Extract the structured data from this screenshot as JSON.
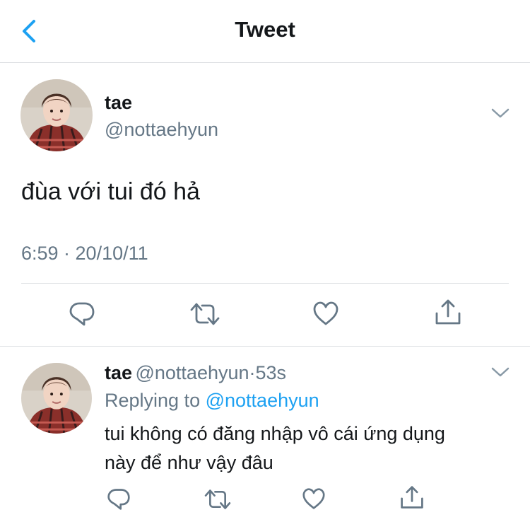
{
  "nav": {
    "title": "Tweet"
  },
  "main_tweet": {
    "name": "tae",
    "handle": "@nottaehyun",
    "text": "đùa với tui đó hả",
    "timestamp": "6:59 · 20/10/11"
  },
  "reply": {
    "name": "tae",
    "handle": "@nottaehyun",
    "separator": "·",
    "time": "53s",
    "replying_prefix": "Replying to",
    "replying_handle": "@nottaehyun",
    "text_line1": "tui không có đăng nhập vô cái ứng dụng",
    "text_line2": "này để như vậy đâu"
  },
  "colors": {
    "accent": "#1da1f2",
    "icon_gray": "#657786",
    "text": "#14171a",
    "divider": "#dcdfe2"
  },
  "icons": [
    "back-chevron-icon",
    "chevron-down-icon",
    "reply-icon",
    "retweet-icon",
    "like-icon",
    "share-icon"
  ]
}
